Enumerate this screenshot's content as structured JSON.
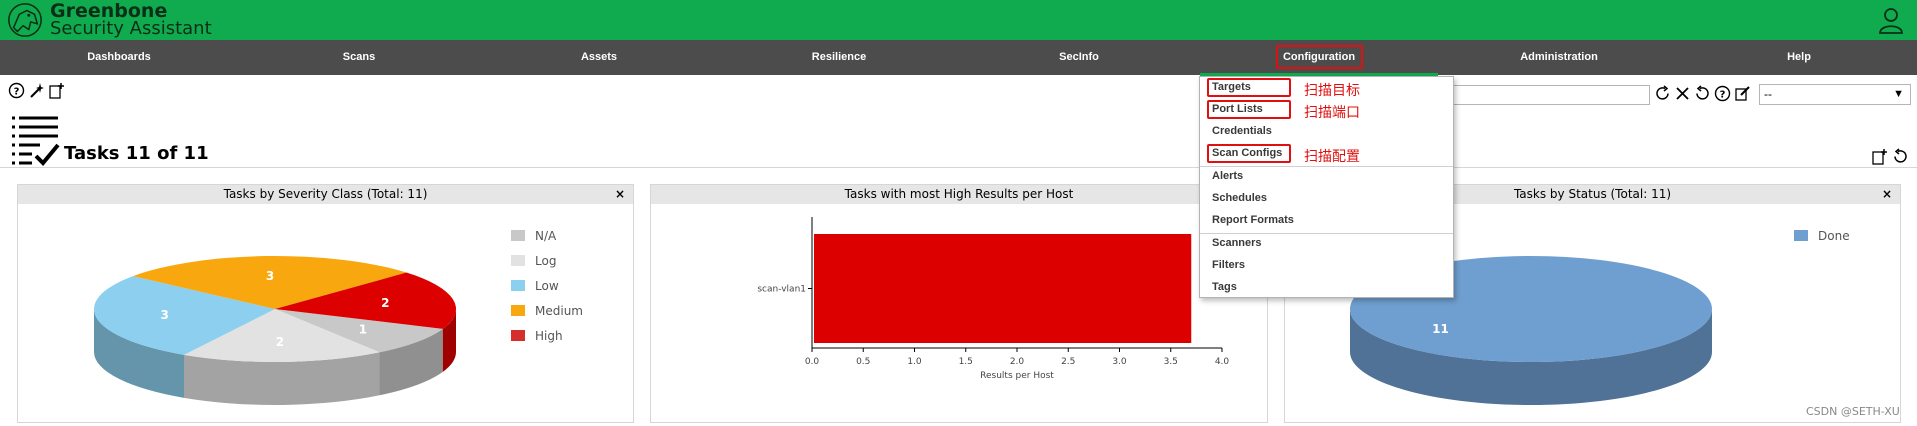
{
  "brand": {
    "line1": "Greenbone",
    "line2": "Security Assistant"
  },
  "nav": {
    "items": [
      {
        "label": "Dashboards"
      },
      {
        "label": "Scans"
      },
      {
        "label": "Assets"
      },
      {
        "label": "Resilience"
      },
      {
        "label": "SecInfo"
      },
      {
        "label": "Configuration",
        "active": true
      },
      {
        "label": "Administration"
      },
      {
        "label": "Help"
      }
    ]
  },
  "page": {
    "title": "Tasks 11 of 11"
  },
  "filter": {
    "value": "",
    "select_value": "--"
  },
  "panels": {
    "severity": {
      "title": "Tasks by Severity Class (Total: 11)",
      "close": "×"
    },
    "high_results": {
      "title": "Tasks with most High Results per Host",
      "close": "×"
    },
    "status": {
      "title": "Tasks by Status (Total: 11)",
      "close": "×"
    }
  },
  "severity_legend": [
    {
      "label": "N/A",
      "color": "#c8c8c8"
    },
    {
      "label": "Log",
      "color": "#e2e2e2"
    },
    {
      "label": "Low",
      "color": "#8ccfee"
    },
    {
      "label": "Medium",
      "color": "#f9a70f"
    },
    {
      "label": "High",
      "color": "#d62d2d"
    }
  ],
  "status_legend": [
    {
      "label": "Done",
      "color": "#6f9fd0"
    }
  ],
  "chart_data": [
    {
      "type": "pie",
      "title": "Tasks by Severity Class (Total: 11)",
      "slices": [
        {
          "label": "N/A",
          "value": 1,
          "color": "#c8c8c8"
        },
        {
          "label": "Log",
          "value": 2,
          "color": "#e2e2e2"
        },
        {
          "label": "Low",
          "value": 3,
          "color": "#8ccfee"
        },
        {
          "label": "Medium",
          "value": 3,
          "color": "#f9a70f"
        },
        {
          "label": "High",
          "value": 2,
          "color": "#dd0000"
        }
      ]
    },
    {
      "type": "bar",
      "orientation": "horizontal",
      "title": "Tasks with most High Results per Host",
      "categories": [
        "scan-vlan1"
      ],
      "values": [
        3.7
      ],
      "xlabel": "Results per Host",
      "xlim": [
        0,
        4
      ],
      "xticks": [
        "0.0",
        "0.5",
        "1.0",
        "1.5",
        "2.0",
        "2.5",
        "3.0",
        "3.5",
        "4.0"
      ],
      "color": "#dd0000"
    },
    {
      "type": "pie",
      "title": "Tasks by Status (Total: 11)",
      "slices": [
        {
          "label": "Done",
          "value": 11,
          "color": "#6f9fd0"
        }
      ]
    }
  ],
  "dropdown": {
    "items": [
      {
        "label": "Targets",
        "annotation": "扫描目标"
      },
      {
        "label": "Port Lists",
        "annotation": "扫描端口"
      },
      {
        "label": "Credentials"
      },
      {
        "label": "Scan Configs",
        "annotation": "扫描配置"
      },
      {
        "label": "Alerts"
      },
      {
        "label": "Schedules"
      },
      {
        "label": "Report Formats"
      },
      {
        "label": "Scanners"
      },
      {
        "label": "Filters"
      },
      {
        "label": "Tags"
      }
    ]
  },
  "watermark": "CSDN @SETH-XU"
}
